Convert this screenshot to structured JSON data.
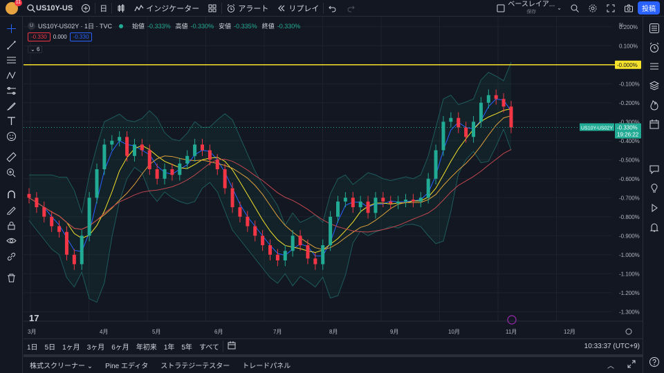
{
  "topbar": {
    "avatar_badge": "11",
    "symbol": "US10Y-US",
    "interval": "日",
    "indicators": "インジケーター",
    "alert": "アラート",
    "replay": "リプレイ",
    "layout_name": "ベースレイア...",
    "layout_sub": "保存",
    "publish": "投稿"
  },
  "legend": {
    "title": "US10Y-US02Y · 1日 · TVC",
    "open_label": "始値",
    "open_value": "-0.333%",
    "high_label": "高値",
    "high_value": "-0.330%",
    "low_label": "安値",
    "low_value": "-0.335%",
    "close_label": "終値",
    "close_value": "-0.330%",
    "bid": "-0.330",
    "spread": "0.000",
    "ask": "-0.330",
    "collapsed_count": "6"
  },
  "price_axis": {
    "unit": "%",
    "ticks": [
      "0.200%",
      "0.100%",
      "-0.100%",
      "-0.200%",
      "-0.300%",
      "-0.400%",
      "-0.500%",
      "-0.600%",
      "-0.700%",
      "-0.800%",
      "-0.900%",
      "-1.000%",
      "-1.100%",
      "-1.200%",
      "-1.300%"
    ],
    "line_label": "-0.000%",
    "symbol_tag": "US10Y-US02Y",
    "last_price": "-0.330%",
    "countdown": "19:26:22"
  },
  "time_axis": {
    "labels": [
      "3月",
      "4月",
      "5月",
      "6月",
      "7月",
      "8月",
      "9月",
      "10月",
      "11月",
      "12月"
    ]
  },
  "timeframes": [
    "1日",
    "5日",
    "1ヶ月",
    "3ヶ月",
    "6ヶ月",
    "年初来",
    "1年",
    "5年",
    "すべて"
  ],
  "clock": "10:33:37 (UTC+9)",
  "bottom_tabs": [
    "株式スクリーナー",
    "Pine エディタ",
    "ストラテジーテスター",
    "トレードパネル"
  ],
  "colors": {
    "bg": "#131722",
    "up": "#22ab94",
    "down": "#f23645",
    "accent": "#2962ff",
    "hline": "#f7e32b",
    "bb": "#1e5c5c"
  },
  "chart_data": {
    "type": "candlestick",
    "y_unit": "%",
    "x_range": [
      "2024-03",
      "2024-12"
    ],
    "y_range": [
      -1.35,
      0.25
    ],
    "horizontal_line": 0.0,
    "series_close": [
      -0.7,
      -0.75,
      -0.8,
      -0.85,
      -0.88,
      -1.0,
      -1.05,
      -0.9,
      -0.7,
      -0.55,
      -0.42,
      -0.4,
      -0.38,
      -0.48,
      -0.42,
      -0.45,
      -0.55,
      -0.6,
      -0.55,
      -0.58,
      -0.52,
      -0.48,
      -0.42,
      -0.45,
      -0.5,
      -0.55,
      -0.65,
      -0.75,
      -0.8,
      -0.85,
      -0.9,
      -0.95,
      -1.0,
      -1.03,
      -0.98,
      -0.9,
      -0.95,
      -1.02,
      -1.05,
      -0.95,
      -0.8,
      -0.72,
      -0.7,
      -0.75,
      -0.72,
      -0.78,
      -0.7,
      -0.72,
      -0.73,
      -0.72,
      -0.71,
      -0.72,
      -0.7,
      -0.6,
      -0.45,
      -0.3,
      -0.28,
      -0.33,
      -0.38,
      -0.3,
      -0.2,
      -0.16,
      -0.18,
      -0.22,
      -0.33
    ],
    "last": -0.33
  }
}
